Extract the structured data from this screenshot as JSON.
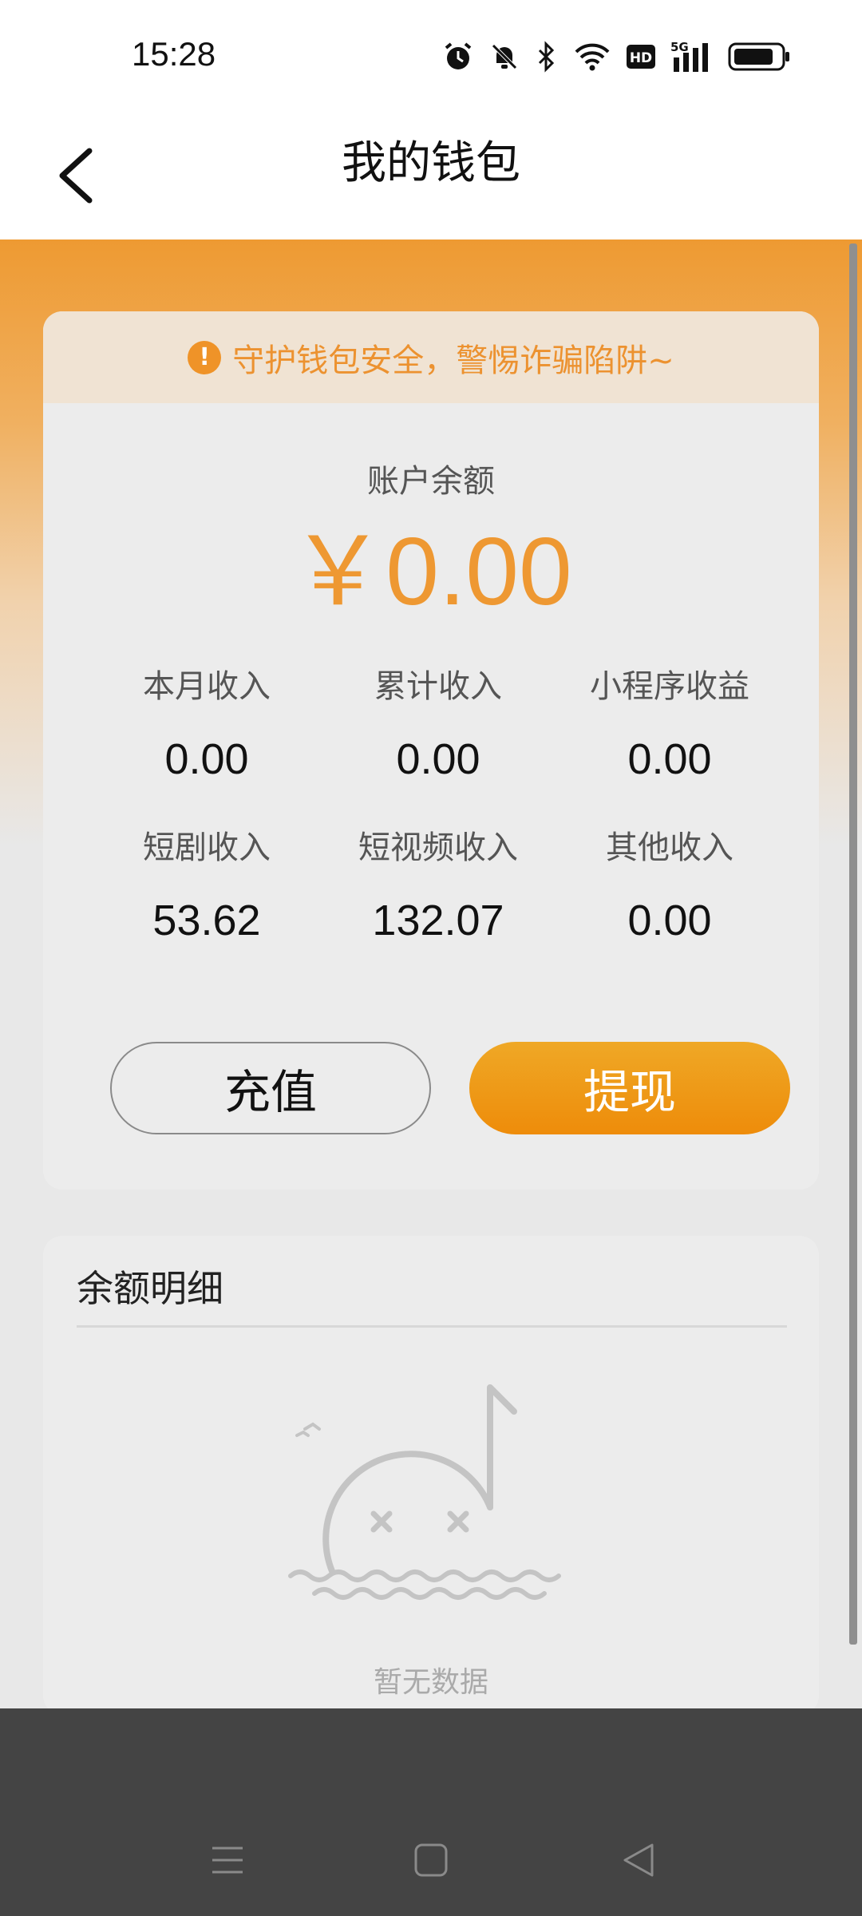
{
  "status_bar": {
    "time": "15:28",
    "icons": [
      "alarm-icon",
      "bell-muted-icon",
      "bluetooth-icon",
      "wifi-icon",
      "hd-icon",
      "signal-5g-icon",
      "battery-icon"
    ]
  },
  "header": {
    "title": "我的钱包",
    "back_icon": "chevron-left-icon"
  },
  "wallet": {
    "warning_text": "守护钱包安全，警惕诈骗陷阱~",
    "warning_icon": "exclamation-circle-icon",
    "balance_label": "账户余额",
    "balance_amount": "￥0.00",
    "stats": [
      {
        "label": "本月收入",
        "value": "0.00"
      },
      {
        "label": "累计收入",
        "value": "0.00"
      },
      {
        "label": "小程序收益",
        "value": "0.00"
      },
      {
        "label": "短剧收入",
        "value": "53.62"
      },
      {
        "label": "短视频收入",
        "value": "132.07"
      },
      {
        "label": "其他收入",
        "value": "0.00"
      }
    ],
    "recharge_label": "充值",
    "withdraw_label": "提现"
  },
  "details": {
    "title": "余额明细",
    "empty_text": "暂无数据",
    "empty_icon": "empty-music-note-illustration"
  },
  "nav": {
    "icons": [
      "menu-icon",
      "home-square-icon",
      "back-triangle-icon"
    ]
  },
  "colors": {
    "accent": "#ee9832",
    "withdraw_gradient_top": "#efa826",
    "withdraw_gradient_bottom": "#ee8c0a",
    "warning_bg": "#f0e3d3",
    "nav_bg": "#444444"
  }
}
